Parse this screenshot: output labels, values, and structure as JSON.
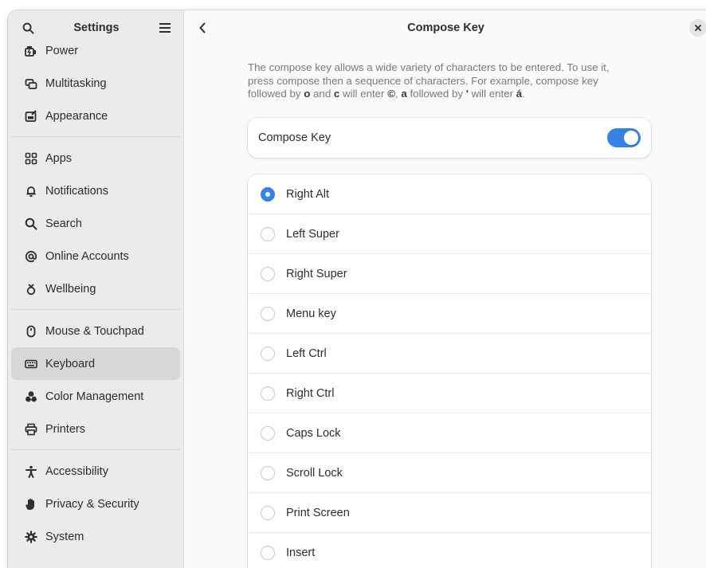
{
  "sidebar": {
    "title": "Settings",
    "groups": [
      [
        {
          "label": "Power",
          "icon": "power-icon"
        },
        {
          "label": "Multitasking",
          "icon": "multitasking-icon"
        },
        {
          "label": "Appearance",
          "icon": "appearance-icon"
        }
      ],
      [
        {
          "label": "Apps",
          "icon": "apps-icon"
        },
        {
          "label": "Notifications",
          "icon": "bell-icon"
        },
        {
          "label": "Search",
          "icon": "search-icon"
        },
        {
          "label": "Online Accounts",
          "icon": "at-icon"
        },
        {
          "label": "Wellbeing",
          "icon": "wellbeing-icon"
        }
      ],
      [
        {
          "label": "Mouse & Touchpad",
          "icon": "mouse-icon"
        },
        {
          "label": "Keyboard",
          "icon": "keyboard-icon"
        },
        {
          "label": "Color Management",
          "icon": "color-icon"
        },
        {
          "label": "Printers",
          "icon": "printer-icon"
        }
      ],
      [
        {
          "label": "Accessibility",
          "icon": "accessibility-icon"
        },
        {
          "label": "Privacy & Security",
          "icon": "hand-icon"
        },
        {
          "label": "System",
          "icon": "gear-icon"
        }
      ]
    ],
    "active": "Keyboard"
  },
  "content": {
    "title": "Compose Key",
    "description": {
      "line1": "The compose key allows a wide variety of characters to be entered. To use it,",
      "line2": "press compose then a sequence of characters.  For example, compose key",
      "line3_a": "followed by ",
      "key_o": "o",
      "line3_b": " and ",
      "key_c": "c",
      "line3_c": " will enter ",
      "result_1": "©",
      "line3_d": ", ",
      "key_a": "a",
      "line3_e": " followed by ",
      "key_apos": "'",
      "line3_f": " will enter ",
      "result_2": "á",
      "line3_g": "."
    },
    "toggle": {
      "label": "Compose Key",
      "on": true
    },
    "options": [
      {
        "label": "Right Alt",
        "checked": true
      },
      {
        "label": "Left Super",
        "checked": false
      },
      {
        "label": "Right Super",
        "checked": false
      },
      {
        "label": "Menu key",
        "checked": false
      },
      {
        "label": "Left Ctrl",
        "checked": false
      },
      {
        "label": "Right Ctrl",
        "checked": false
      },
      {
        "label": "Caps Lock",
        "checked": false
      },
      {
        "label": "Scroll Lock",
        "checked": false
      },
      {
        "label": "Print Screen",
        "checked": false
      },
      {
        "label": "Insert",
        "checked": false
      }
    ]
  },
  "colors": {
    "accent": "#3584e4",
    "sidebar_bg": "#ebebed",
    "active_bg": "#d7d7d9"
  }
}
